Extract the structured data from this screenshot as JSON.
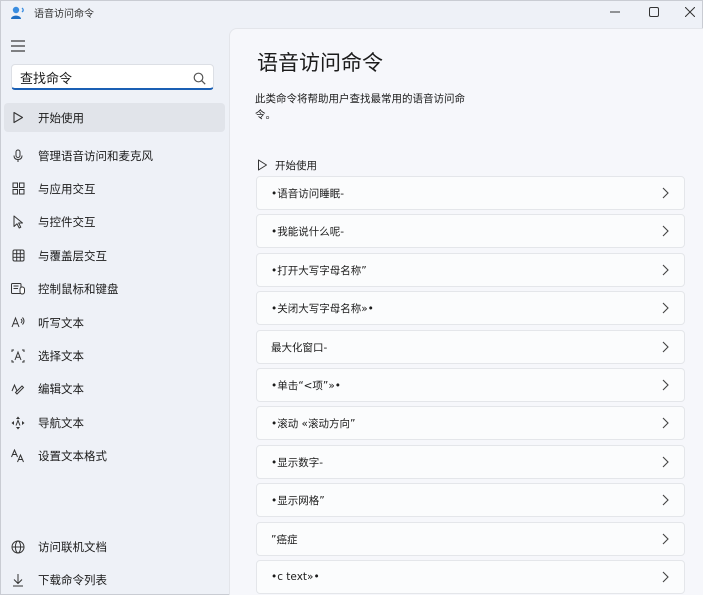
{
  "window": {
    "title": "语音访问命令"
  },
  "sidebar": {
    "search": {
      "value": "查找命令"
    },
    "items": [
      {
        "label": "开始使用",
        "icon": "play-icon",
        "active": true
      },
      {
        "label": "管理语音访问和麦克风",
        "icon": "microphone-icon"
      },
      {
        "label": "与应用交互",
        "icon": "apps-icon"
      },
      {
        "label": "与控件交互",
        "icon": "cursor-icon"
      },
      {
        "label": "与覆盖层交互",
        "icon": "grid-icon"
      },
      {
        "label": "控制鼠标和键盘",
        "icon": "keyboard-mouse-icon"
      },
      {
        "label": "听写文本",
        "icon": "dictate-icon"
      },
      {
        "label": "选择文本",
        "icon": "select-text-icon"
      },
      {
        "label": "编辑文本",
        "icon": "edit-text-icon"
      },
      {
        "label": "导航文本",
        "icon": "navigate-text-icon"
      },
      {
        "label": "设置文本格式",
        "icon": "format-text-icon"
      }
    ],
    "footer_items": [
      {
        "label": "访问联机文档",
        "icon": "globe-icon"
      },
      {
        "label": "下载命令列表",
        "icon": "download-icon"
      }
    ]
  },
  "main": {
    "title": "语音访问命令",
    "description": "此类命令将帮助用户查找最常用的语音访问命令。",
    "section": {
      "label": "开始使用",
      "icon": "play-icon"
    },
    "commands": [
      "•语音访问睡眠-",
      "•我能说什么呢-",
      "•打开大写字母名称”",
      "•关闭大写字母名称»•",
      "最大化窗口-",
      "•单击“<项”»•",
      "•滚动 «滚动方向”",
      "•显示数字-",
      "•显示网格”",
      "”癌症",
      "•c text»•"
    ]
  }
}
